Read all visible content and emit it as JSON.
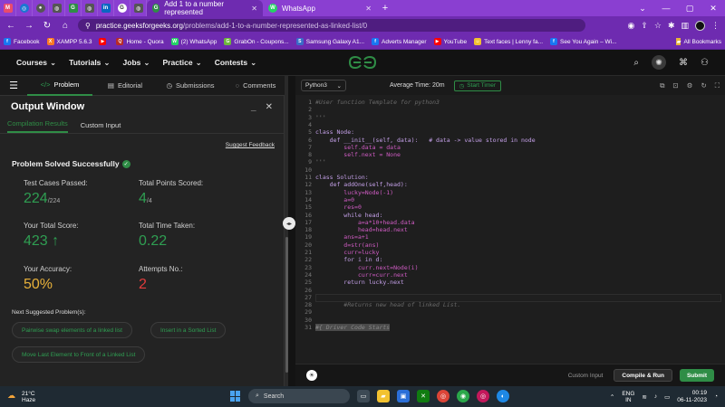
{
  "browser": {
    "active_tab_title": "Add 1 to a number represented",
    "whatsapp_tab_title": "WhatsApp",
    "new_tab": "+",
    "url_host": "practice.geeksforgeeks.org",
    "url_path": "/problems/add-1-to-a-number-represented-as-linked-list/0",
    "bookmarks": [
      {
        "label": "Facebook",
        "color": "#1877f2",
        "glyph": "f"
      },
      {
        "label": "XAMPP 5.6.3",
        "color": "#fb7a24",
        "glyph": "X"
      },
      {
        "label": "",
        "color": "#ff0000",
        "glyph": "▶"
      },
      {
        "label": "Home - Quora",
        "color": "#b92b27",
        "glyph": "Q"
      },
      {
        "label": "(2) WhatsApp",
        "color": "#25d366",
        "glyph": "W"
      },
      {
        "label": "GrabOn - Coupons...",
        "color": "#6fb83d",
        "glyph": "G"
      },
      {
        "label": "Samsung Galaxy A1...",
        "color": "#3a6cc8",
        "glyph": "S"
      },
      {
        "label": "Adverts Manager",
        "color": "#1877f2",
        "glyph": "f"
      },
      {
        "label": "YouTube",
        "color": "#ff0000",
        "glyph": "▶"
      },
      {
        "label": "Text faces | Lenny fa...",
        "color": "#f2c230",
        "glyph": "☺"
      },
      {
        "label": "See You Again – Wi...",
        "color": "#1877f2",
        "glyph": "f"
      }
    ],
    "all_bookmarks": "All Bookmarks"
  },
  "gfg_nav": {
    "items": [
      "Courses",
      "Tutorials",
      "Jobs",
      "Practice",
      "Contests"
    ]
  },
  "problem_tabs": [
    "Problem",
    "Editorial",
    "Submissions",
    "Comments"
  ],
  "output": {
    "title": "Output Window",
    "tabs": [
      "Compilation Results",
      "Custom Input"
    ],
    "suggest": "Suggest Feedback",
    "solved": "Problem Solved Successfully",
    "labels": {
      "test_cases": "Test Cases Passed:",
      "total_points": "Total Points Scored:",
      "total_score": "Your Total Score:",
      "total_time": "Total Time Taken:",
      "accuracy": "Your Accuracy:",
      "attempts": "Attempts No.:"
    },
    "values": {
      "test_cases": "224",
      "test_cases_total": "/224",
      "points": "4",
      "points_total": "/4",
      "score": "423",
      "time": "0.22",
      "accuracy": "50%",
      "attempts": "2"
    },
    "next_suggested": "Next Suggested Problem(s):",
    "suggestions": [
      "Pairwise swap elements of a linked list",
      "Insert in a Sorted List",
      "Move Last Element to Front of a Linked List"
    ]
  },
  "editor": {
    "language": "Python3",
    "avg_time": "Average Time: 20m",
    "timer": "Start Timer",
    "custom_input": "Custom Input",
    "compile_run": "Compile & Run",
    "submit": "Submit",
    "lines": [
      "#User function Template for python3",
      "",
      "'''",
      "",
      "class Node:",
      "    def __init__(self, data):   # data -> value stored in node",
      "        self.data = data",
      "        self.next = None",
      "'''",
      "",
      "class Solution:",
      "    def addOne(self,head):",
      "        lucky=Node(-1)",
      "        a=0",
      "        res=0",
      "        while head:",
      "            a=a*10+head.data",
      "            head=head.next",
      "        ans=a+1",
      "        d=str(ans)",
      "        curr=lucky",
      "        for i in d:",
      "            curr.next=Node(i)",
      "            curr=curr.next",
      "        return lucky.next",
      "",
      "        ",
      "        #Returns new head of linked List.",
      "",
      "",
      "#{ Driver Code Starts"
    ]
  },
  "taskbar": {
    "temp": "21°C",
    "weather": "Haze",
    "search": "Search",
    "lang_top": "ENG",
    "lang_bottom": "IN",
    "time": "00:19",
    "date": "06-11-2023"
  },
  "colors": {
    "chrome_purple": "#6e2bb0",
    "gfg_green": "#2f8d46",
    "accuracy_yellow": "#e8b13a",
    "attempts_red": "#e23c3c"
  }
}
